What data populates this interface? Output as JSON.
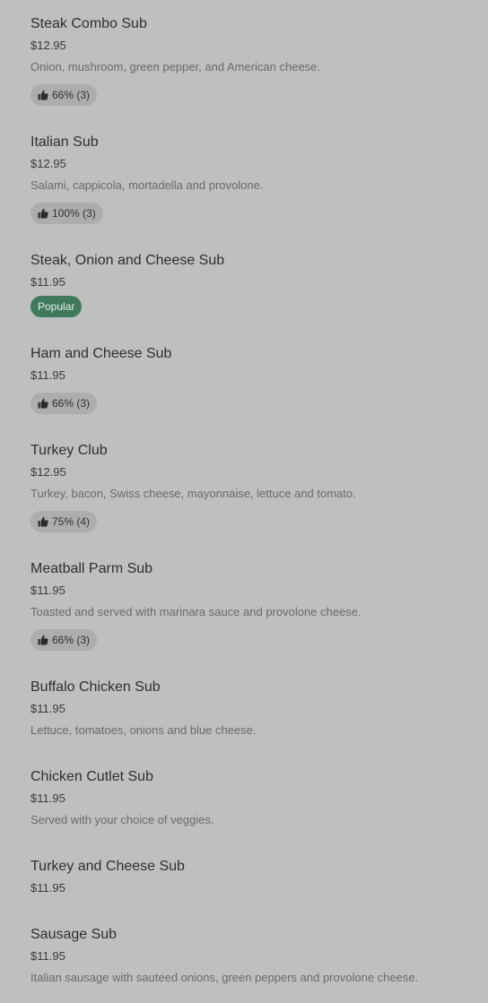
{
  "colors": {
    "background": "#bfbfbf",
    "popular_badge": "#3f7a5c",
    "rating_badge": "#adadad"
  },
  "menu": {
    "items": [
      {
        "name": "Steak Combo Sub",
        "price": "$12.95",
        "description": "Onion, mushroom, green pepper, and American cheese.",
        "rating": "66% (3)"
      },
      {
        "name": "Italian Sub",
        "price": "$12.95",
        "description": "Salami, cappicola, mortadella and provolone.",
        "rating": "100% (3)"
      },
      {
        "name": "Steak, Onion and Cheese Sub",
        "price": "$11.95",
        "badge": "Popular"
      },
      {
        "name": "Ham and Cheese Sub",
        "price": "$11.95",
        "rating": "66% (3)"
      },
      {
        "name": "Turkey Club",
        "price": "$12.95",
        "description": "Turkey, bacon, Swiss cheese, mayonnaise, lettuce and tomato.",
        "rating": "75% (4)"
      },
      {
        "name": "Meatball Parm Sub",
        "price": "$11.95",
        "description": "Toasted and served with marinara sauce and provolone cheese.",
        "rating": "66% (3)"
      },
      {
        "name": "Buffalo Chicken Sub",
        "price": "$11.95",
        "description": "Lettuce, tomatoes, onions and blue cheese."
      },
      {
        "name": "Chicken Cutlet Sub",
        "price": "$11.95",
        "description": "Served with your choice of veggies."
      },
      {
        "name": "Turkey and Cheese Sub",
        "price": "$11.95"
      },
      {
        "name": "Sausage Sub",
        "price": "$11.95",
        "description": "Italian sausage with sauteed onions, green peppers and provolone cheese."
      }
    ]
  }
}
